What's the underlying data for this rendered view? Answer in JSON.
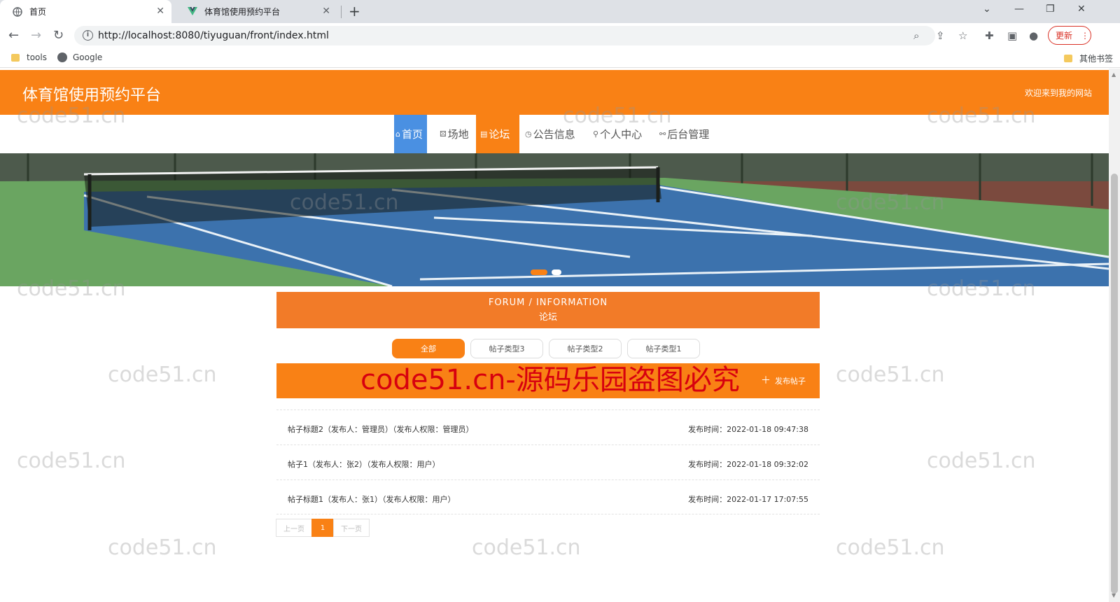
{
  "browser": {
    "tabs": [
      {
        "title": "首页",
        "active": true
      },
      {
        "title": "体育馆使用预约平台",
        "active": false
      }
    ],
    "url": "http://localhost:8080/tiyuguan/front/index.html",
    "update_label": "更新",
    "bookmarks": [
      {
        "label": "tools",
        "icon": "folder-icon"
      },
      {
        "label": "Google",
        "icon": "globe-icon"
      }
    ],
    "other_bookmarks": "其他书签"
  },
  "site": {
    "title": "体育馆使用预约平台",
    "welcome": "欢迎来到我的网站",
    "brand_color": "#f98115"
  },
  "nav": [
    {
      "label": "首页",
      "icon": "home-icon"
    },
    {
      "label": "场地",
      "icon": "venue-icon"
    },
    {
      "label": "论坛",
      "icon": "forum-icon"
    },
    {
      "label": "公告信息",
      "icon": "notice-icon"
    },
    {
      "label": "个人中心",
      "icon": "user-icon"
    },
    {
      "label": "后台管理",
      "icon": "link-icon"
    }
  ],
  "forum": {
    "title_en": "FORUM / INFORMATION",
    "title_cn": "论坛",
    "categories": [
      "全部",
      "帖子类型3",
      "帖子类型2",
      "帖子类型1"
    ],
    "publish_label": "发布帖子",
    "posts": [
      {
        "title": "帖子标题2（发布人：管理员）（发布人权限：管理员）",
        "time": "发布时间：2022-01-18 09:47:38"
      },
      {
        "title": "帖子1（发布人：张2）（发布人权限：用户）",
        "time": "发布时间：2022-01-18 09:32:02"
      },
      {
        "title": "帖子标题1（发布人：张1）（发布人权限：用户）",
        "time": "发布时间：2022-01-17 17:07:55"
      }
    ],
    "pager": {
      "prev": "上一页",
      "page": "1",
      "next": "下一页"
    }
  },
  "watermark": {
    "text": "code51.cn",
    "notice": "code51.cn-源码乐园盗图必究"
  }
}
